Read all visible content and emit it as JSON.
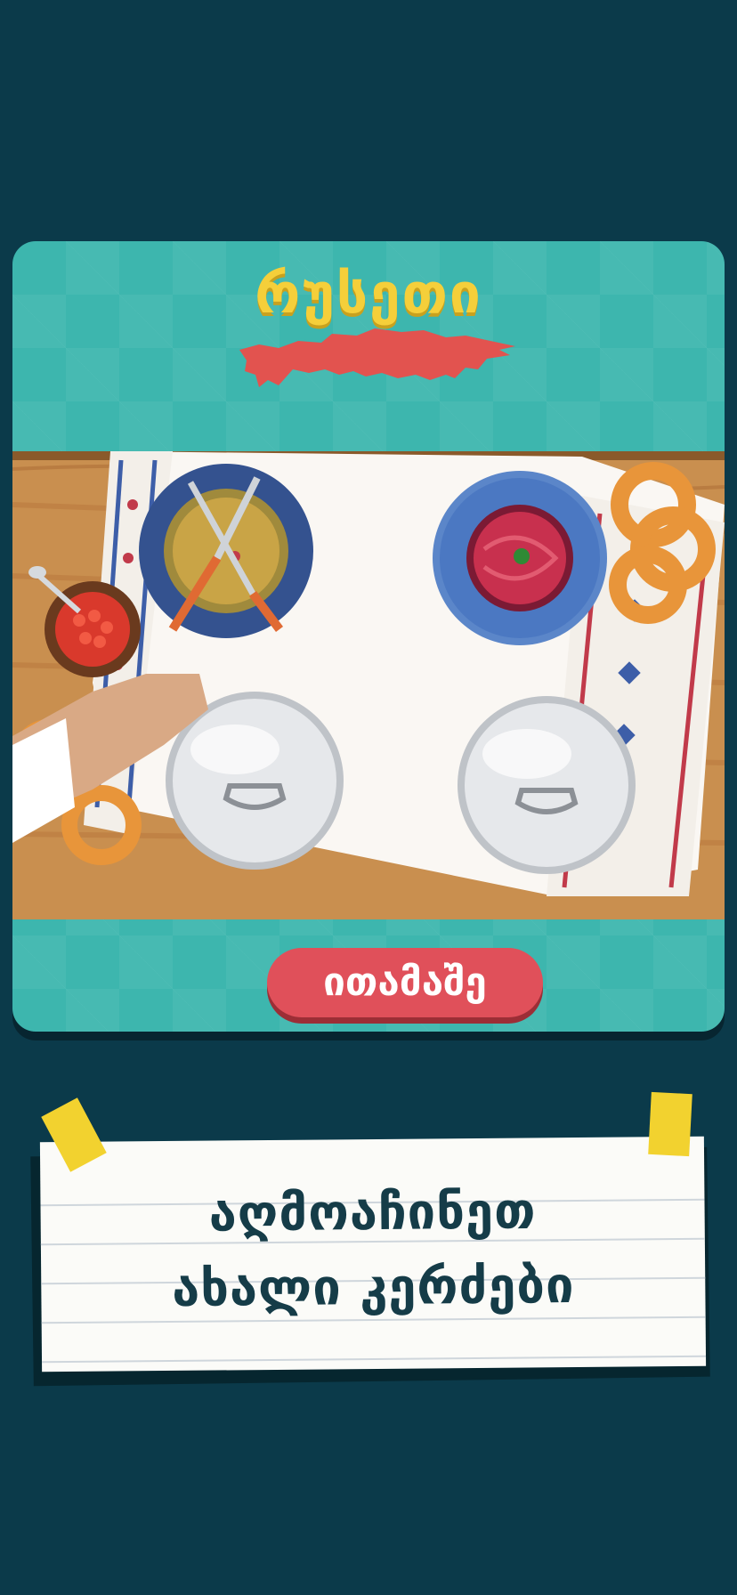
{
  "level": {
    "country_name": "რუსეთი",
    "play_label": "ითამაშე"
  },
  "promo": {
    "line1": "აღმოაჩინეთ",
    "line2": "ახალი კერძები"
  },
  "colors": {
    "background": "#0b3a4a",
    "card": "#3db6ae",
    "title": "#f5cf3a",
    "map": "#e2534f",
    "button": "#e0505a",
    "text_dark": "#153c48"
  },
  "icons": [
    "russia-map-icon",
    "fork-icon",
    "knife-icon",
    "spoon-icon",
    "pretzel-icon",
    "cloche-icon",
    "hand-icon"
  ]
}
